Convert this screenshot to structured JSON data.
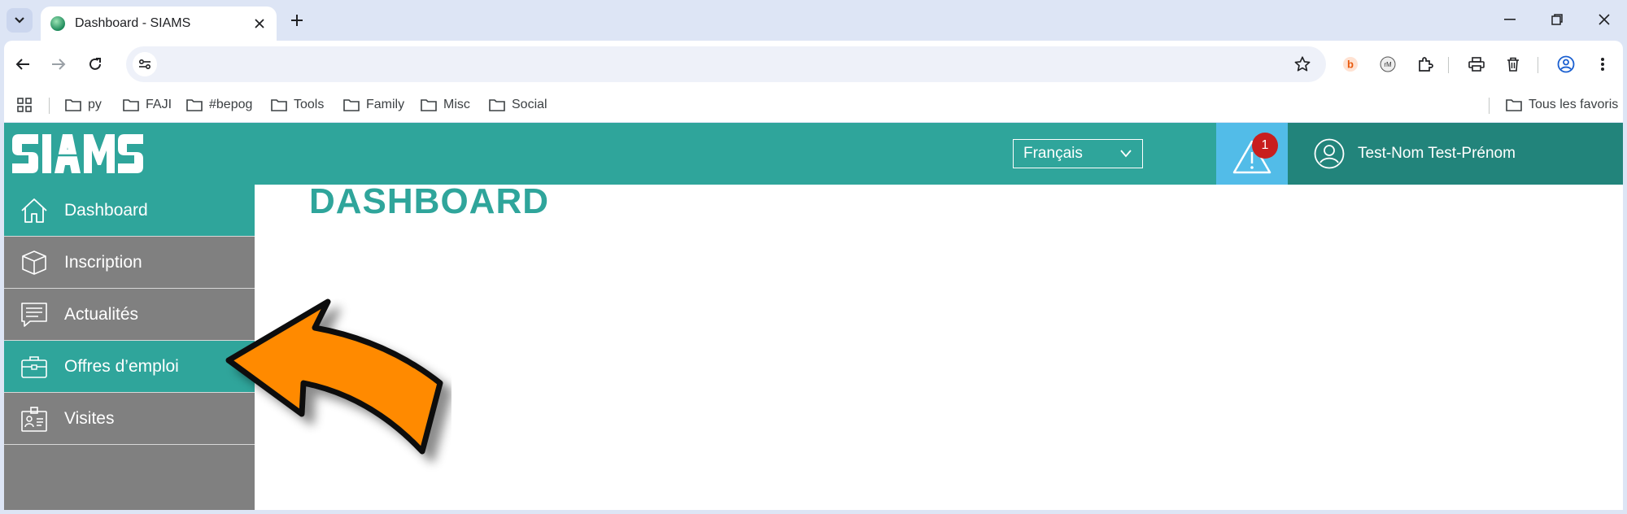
{
  "browser": {
    "tab_title": "Dashboard - SIAMS",
    "bookmarks": [
      "py",
      "FAJI",
      "#bepog",
      "Tools",
      "Family",
      "Misc",
      "Social"
    ],
    "all_bookmarks": "Tous les favoris"
  },
  "header": {
    "language": "Français",
    "alert_count": "1",
    "user_name": "Test-Nom Test-Prénom"
  },
  "sidebar": {
    "items": [
      {
        "label": "Dashboard",
        "icon": "home-icon"
      },
      {
        "label": "Inscription",
        "icon": "box-icon"
      },
      {
        "label": "Actualités",
        "icon": "news-icon"
      },
      {
        "label": "Offres d’emploi",
        "icon": "briefcase-icon"
      },
      {
        "label": "Visites",
        "icon": "id-card-icon"
      }
    ]
  },
  "main": {
    "title": "DASHBOARD"
  },
  "colors": {
    "teal": "#2fa59b",
    "teal_dark": "#22847b",
    "alert_blue": "#52bce8",
    "sidebar_grey": "#808080",
    "badge_red": "#c81e1e",
    "arrow_orange": "#ff8a00"
  }
}
